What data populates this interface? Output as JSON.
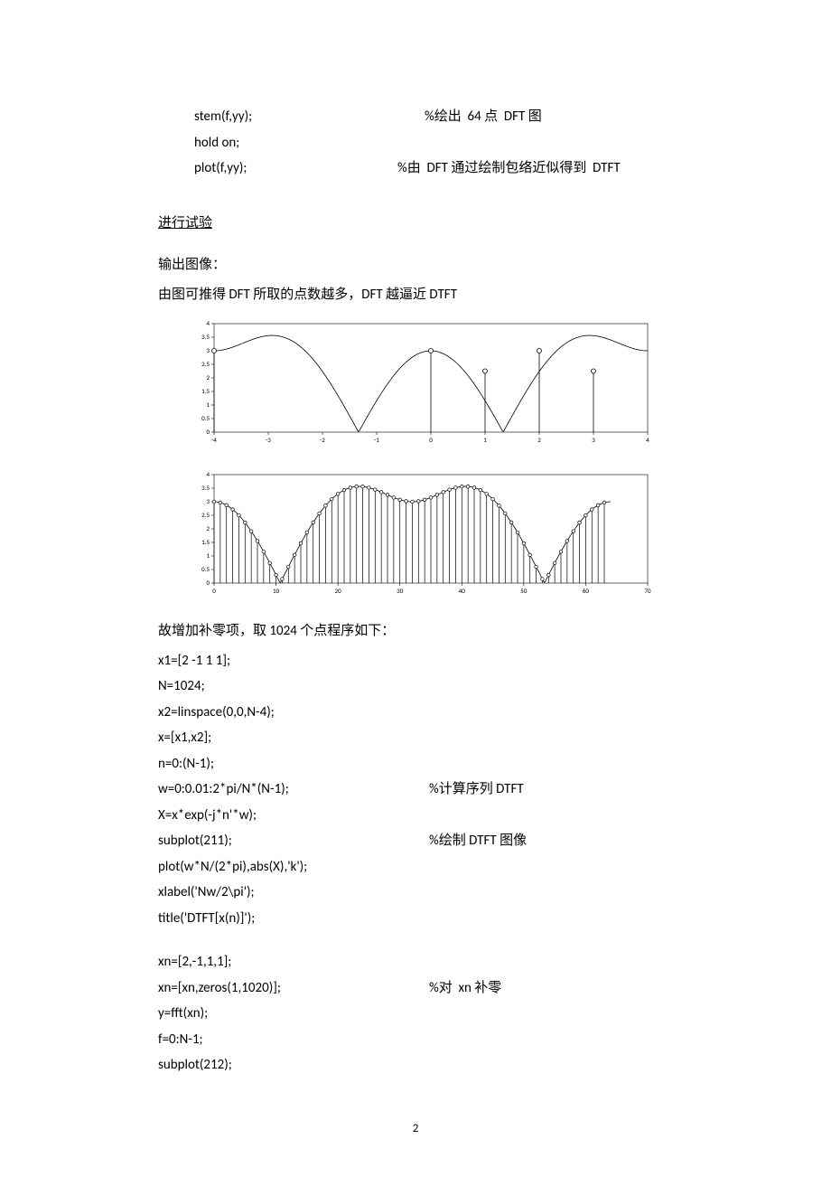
{
  "code_block_top": {
    "l1_code": "stem(f,yy);",
    "l1_cmt": "%绘出  64 点  DFT 图",
    "l2_code": "hold on;",
    "l3_code": "plot(f,yy);",
    "l3_cmt": "%由  DFT 通过绘制包络近似得到  DTFT"
  },
  "heading": "进行试验",
  "paragraph1": "输出图像：",
  "paragraph2": "由图可推得 DFT 所取的点数越多，DFT 越逼近 DTFT",
  "chart_data": [
    {
      "type": "line",
      "title": "",
      "xlabel": "",
      "ylabel": "",
      "xlim": [
        -4,
        4
      ],
      "ylim": [
        0,
        4
      ],
      "xticks": [
        -4,
        -3,
        -2,
        -1,
        0,
        1,
        2,
        3,
        4
      ],
      "yticks": [
        0,
        0.5,
        1,
        1.5,
        2,
        2.5,
        3,
        3.5,
        4
      ],
      "series": [
        {
          "name": "envelope",
          "style": "line",
          "note": "DTFT magnitude envelope over ω ∈ [-π,π] scaled to [-4,4]; periodic with zeros near ±1"
        }
      ],
      "stems": [
        {
          "x": -4,
          "y": 3.0
        },
        {
          "x": 0,
          "y": 3.0
        },
        {
          "x": 1,
          "y": 2.25
        },
        {
          "x": 2,
          "y": 3.0
        },
        {
          "x": 3,
          "y": 2.25
        }
      ]
    },
    {
      "type": "bar",
      "title": "",
      "xlabel": "",
      "ylabel": "",
      "xlim": [
        0,
        70
      ],
      "ylim": [
        0,
        4
      ],
      "xticks": [
        0,
        10,
        20,
        30,
        40,
        50,
        60,
        70
      ],
      "yticks": [
        0,
        0.5,
        1,
        1.5,
        2,
        2.5,
        3,
        3.5,
        4
      ],
      "N": 64,
      "note": "64-point DFT magnitude stems with overlaid envelope; peaks ≈ 3.5 around k≈28 and k≈36; zeros near k≈10 and k≈54"
    }
  ],
  "paragraph3": "故增加补零项，取 1024 个点程序如下：",
  "code_block_mid": {
    "l1": "x1=[2 -1 1 1];",
    "l2": "N=1024;",
    "l3": "x2=linspace(0,0,N-4);",
    "l4": "x=[x1,x2];",
    "l5": "n=0:(N-1);",
    "l6_code": "w=0:0.01:2*pi/N*(N-1);",
    "l6_cmt": "%计算序列 DTFT",
    "l7": "X=x*exp(-j*n'*w);",
    "l8_code": "subplot(211);",
    "l8_cmt": "%绘制 DTFT 图像",
    "l9": "plot(w*N/(2*pi),abs(X),'k');",
    "l10": "xlabel('Nw/2\\pi');",
    "l11": "title('DTFT[x(n)]');"
  },
  "code_block_bot": {
    "l1": "xn=[2,-1,1,1];",
    "l2_code": "xn=[xn,zeros(1,1020)];",
    "l2_cmt": "%对  xn 补零",
    "l3": "y=fft(xn);",
    "l4": "f=0:N-1;",
    "l5": "subplot(212);"
  },
  "page_number": "2"
}
